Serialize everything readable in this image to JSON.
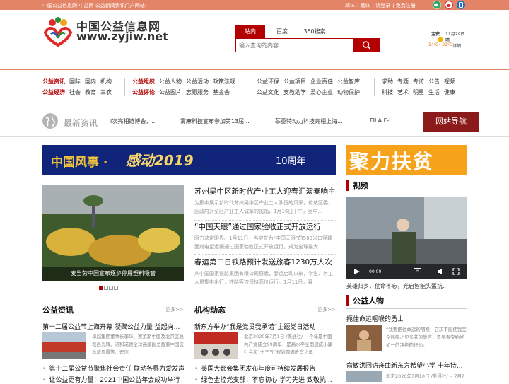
{
  "topbar": {
    "slogan": "中国公益信息网-中益网 公益新闻资讯门户网站!",
    "links": [
      "简体",
      "繁体",
      "请登录",
      "免费注册"
    ]
  },
  "header": {
    "logo_cn": "中国公益信息网",
    "logo_en": "www.zyjiw.net"
  },
  "search": {
    "tabs": [
      "站内",
      "百度",
      "360搜索"
    ],
    "placeholder": "输入查询的内容"
  },
  "weather": {
    "city": "宝安",
    "date": "11月29日",
    "condition": "晴",
    "temp": "14℃~22℃",
    "detail": "详细"
  },
  "nav": {
    "groups": [
      {
        "rows": [
          [
            "公益资讯",
            "国际",
            "国内",
            "机构"
          ],
          [
            "公益经济",
            "社会",
            "教育",
            "三农"
          ]
        ]
      },
      {
        "rows": [
          [
            "公益组织",
            "公益人物",
            "公益活动",
            "政策法规"
          ],
          [
            "公益评论",
            "公益图片",
            "志愿服务",
            "基金会"
          ]
        ]
      },
      {
        "rows": [
          [
            "公益环保",
            "公益项目",
            "企业责任",
            "公益智库"
          ],
          [
            "公益文化",
            "支教助学",
            "爱心企业",
            "动物保护"
          ]
        ]
      },
      {
        "rows": [
          [
            "求助",
            "专题",
            "专访",
            "公告",
            "视频"
          ],
          [
            "科技",
            "艺术",
            "明星",
            "生活",
            "健康"
          ]
        ]
      }
    ]
  },
  "ticker": {
    "label": "最新资讯",
    "items": [
      "i次亮相链博会，...",
      "雾麻科技宣布参加第13届...",
      "菲亚特动力科技亮相上海...",
      "FILA F-I"
    ],
    "button": "网站导航"
  },
  "banners": {
    "main_part1": "中国风事 ·",
    "main_part2": "感动2019",
    "main_part3": "10周年",
    "side": "聚力扶贫"
  },
  "slider": {
    "caption": "麦当劳中国宣布逐步停用塑料吸管",
    "dots": 4,
    "active": 0
  },
  "headlines": [
    {
      "title": "苏州吴中区新时代产业工人迎春汇演奏响主旋",
      "desc": "为集中展示新时代苏州吴中区产业工人队伍的风采，传达区委、区政府对全区产业工人诚挚的祝福，1月16日下午，吴中..."
    },
    {
      "title": "“中国天眼”通过国家验收正式开放运行",
      "desc": "眼力决定眼界。1月11日，当被誉为“中国天眼”的500米口径球面射电望远镜通过国家验收正式开放运行，成为全球最大..."
    },
    {
      "title": "春运第二日铁路预计发送旅客1230万人次",
      "desc": "从中国国家铁路集团有限公司获悉，春运启动以来，学生、务工人员集中出行，铁路客流保持高位运行。1月11日，春"
    }
  ],
  "section_news": {
    "title": "公益资讯",
    "more": "更多>>",
    "lead_title": "第十二届公益节上海开幕 凝聚公益力量 益起向...",
    "lead_desc": "卓越集团董事长李华、赛莱斯中国及北京区总裁吕光辉、诺和诺德全球高级副总裁兼中国区总裁周霞等、宏信",
    "items": [
      "第十二届公益节聚焦社会责任 联动各界为爱发声",
      "让公益更有力量！2021中国公益年会成功举行"
    ]
  },
  "section_org": {
    "title": "机构动态",
    "more": "更多>>",
    "lead_title": "新东方举办“我是党员我承诺”主题党日活动",
    "lead_desc": "北京2020年7月1日 /美通社/ -- 今年是中国共产党成立99周年，是高水平全面建成小康社会和“十三五”规划圆满收官之年",
    "items": [
      "美国大都会集团发布年度可持续发展报告",
      "绿色金控党支部：不忘初心 学习先进 致敬抗..."
    ]
  },
  "video": {
    "title": "视频",
    "time": "00:00",
    "caption": "英雄归乡，使命不忘，光启智能头盔抗..."
  },
  "people": {
    "title": "公益人物",
    "lead_title": "扼住命运咽喉的勇士",
    "lead_desc": "“我要把住命运的咽喉，它决不能使我完全屈服。”贝多芬的誓言，是吴春宝始终如一的决绝的行动。",
    "second_title": "俞敏洪回访舟曲新东方希望小学 十年持...",
    "second_desc": "北京2020年7月10日 /美通社/ -- 7月7"
  }
}
